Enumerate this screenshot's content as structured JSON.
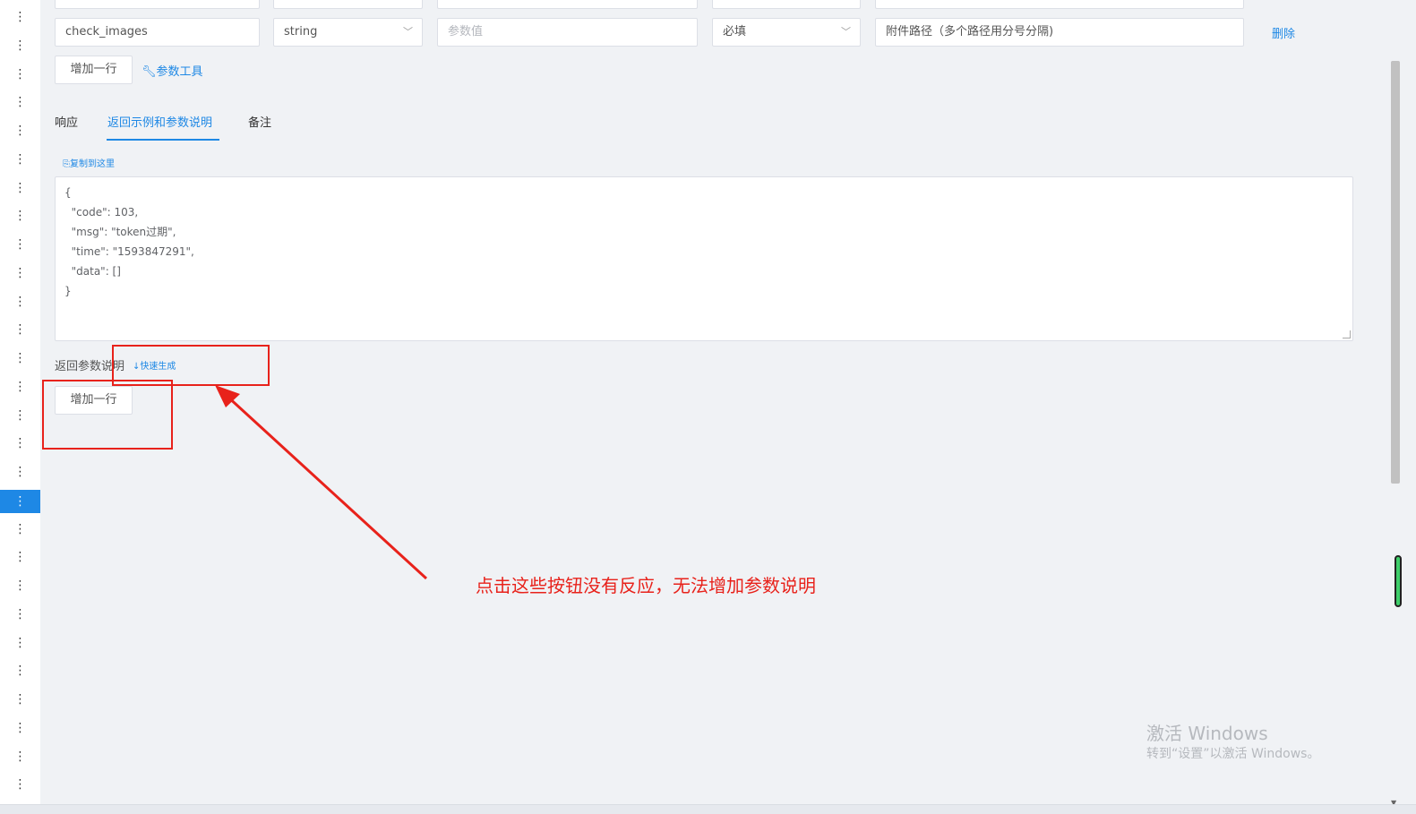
{
  "row_prev": {
    "name": "",
    "type": ""
  },
  "param_row": {
    "name_value": "check_images",
    "type_value": "string",
    "value_placeholder": "参数值",
    "required_value": "必填",
    "desc_value": "附件路径（多个路径用分号分隔)",
    "delete_label": "删除"
  },
  "toolbar": {
    "add_row_label": "增加一行",
    "param_tool_label": "参数工具"
  },
  "tabs": [
    {
      "label": "响应",
      "active": false
    },
    {
      "label": "返回示例和参数说明",
      "active": true
    },
    {
      "label": "备注",
      "active": false
    }
  ],
  "copy_here_label": "复制到这里",
  "response_example": [
    "{",
    "  \"code\": 103,",
    "  \"msg\": \"token过期\",",
    "  \"time\": \"1593847291\",",
    "  \"data\": []",
    "}"
  ],
  "return_params": {
    "label": "返回参数说明",
    "quick_gen_label": "快速生成",
    "add_row_label": "增加一行"
  },
  "annotation_text": "点击这些按钮没有反应，无法增加参数说明",
  "watermark": {
    "title": "激活 Windows",
    "subtitle": "转到“设置”以激活 Windows。"
  },
  "colors": {
    "accent": "#1e88e5",
    "annotation_red": "#e8221b",
    "background": "#f0f2f5"
  }
}
